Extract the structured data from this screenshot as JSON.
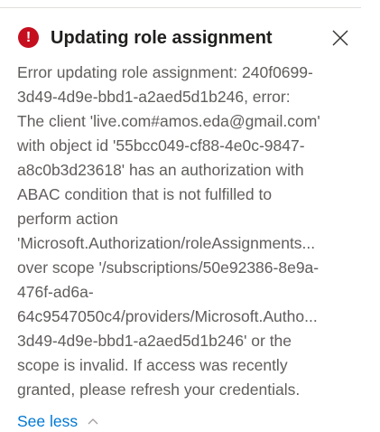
{
  "notification": {
    "title": "Updating role assignment",
    "icon": "error-icon",
    "icon_glyph": "!",
    "error_color": "#c50f1f",
    "link_color": "#0078d4",
    "message_lines": [
      "Error updating role assignment: 240f0699-",
      "3d49-4d9e-bbd1-a2aed5d1b246, error:",
      "The client 'live.com#amos.eda@gmail.com'",
      "with object id '55bcc049-cf88-4e0c-9847-",
      "a8c0b3d23618' has an authorization with",
      "ABAC condition that is not fulfilled to",
      "perform action",
      "'Microsoft.Authorization/roleAssignments...",
      "over scope '/subscriptions/50e92386-8e9a-",
      "476f-ad6a-",
      "64c9547050c4/providers/Microsoft.Autho...",
      "3d49-4d9e-bbd1-a2aed5d1b246' or the",
      "scope is invalid. If access was recently",
      "granted, please refresh your credentials."
    ],
    "see_less_label": "See less",
    "chevron_icon": "chevron-up-icon"
  }
}
